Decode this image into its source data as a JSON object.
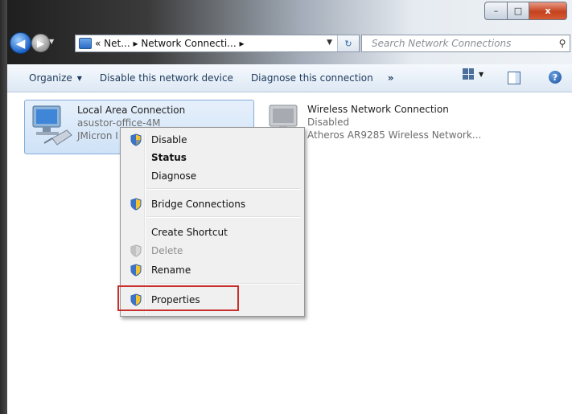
{
  "window": {
    "caption_minimize": "–",
    "caption_maximize": "□",
    "caption_close": "x"
  },
  "address": {
    "back_glyph": "◀",
    "forward_glyph": "▶",
    "path": "« Net...  ▸ Network Connecti...  ▸",
    "refresh_glyph": "↻",
    "search_placeholder": "Search Network Connections"
  },
  "commandbar": {
    "organize": "Organize",
    "disable_device": "Disable this network device",
    "diagnose": "Diagnose this connection",
    "more": "»",
    "help": "?"
  },
  "connections": [
    {
      "name": "Local Area Connection",
      "line2": "asustor-office-4M",
      "line3": "JMicron I",
      "selected": true
    },
    {
      "name": "Wireless Network Connection",
      "line2": "Disabled",
      "line3": "Atheros AR9285 Wireless Network...",
      "selected": false
    }
  ],
  "context_menu": {
    "items": [
      {
        "label": "Disable",
        "shield": true,
        "style": "normal"
      },
      {
        "label": "Status",
        "shield": false,
        "style": "bold"
      },
      {
        "label": "Diagnose",
        "shield": false,
        "style": "normal"
      },
      {
        "label": "Bridge Connections",
        "shield": true,
        "style": "normal"
      },
      {
        "label": "Create Shortcut",
        "shield": false,
        "style": "normal"
      },
      {
        "label": "Delete",
        "shield": true,
        "style": "disabled"
      },
      {
        "label": "Rename",
        "shield": true,
        "style": "normal"
      },
      {
        "label": "Properties",
        "shield": true,
        "style": "normal",
        "highlighted": true
      }
    ]
  },
  "colors": {
    "highlight_border": "#c9302c",
    "selection_fill": "#cfe2f7",
    "commandbar_text": "#1e395b"
  }
}
